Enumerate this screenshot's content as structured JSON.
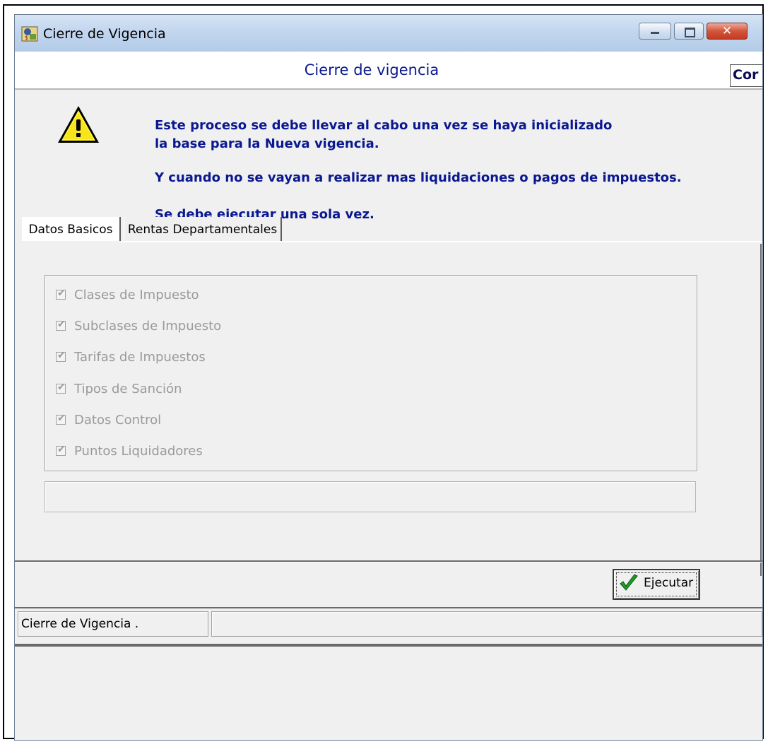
{
  "window": {
    "title": "Cierre de Vigencia",
    "app_icon": "taxes-app-icon",
    "controls": {
      "minimize": "minimize-icon",
      "maximize": "maximize-icon",
      "close": "close-icon"
    },
    "close_glyph": "✕"
  },
  "header": {
    "title": "Cierre de vigencia",
    "right_field_text": "Cor"
  },
  "warning": {
    "icon": "warning-icon",
    "lines": [
      "Este proceso se debe llevar al cabo una vez se haya inicializado",
      "la base para la Nueva vigencia.",
      "Y cuando no se vayan a realizar mas liquidaciones o pagos de impuestos.",
      "Se debe ejecutar una sola vez."
    ]
  },
  "tabs": [
    {
      "label": "Datos Basicos",
      "active": true
    },
    {
      "label": "Rentas Departamentales",
      "active": false
    }
  ],
  "checklist": [
    {
      "label": "Clases de Impuesto",
      "checked": true,
      "enabled": false
    },
    {
      "label": "Subclases de Impuesto",
      "checked": true,
      "enabled": false
    },
    {
      "label": "Tarifas de Impuestos",
      "checked": true,
      "enabled": false
    },
    {
      "label": "Tipos de Sanción",
      "checked": true,
      "enabled": false
    },
    {
      "label": "Datos Control",
      "checked": true,
      "enabled": false
    },
    {
      "label": "Puntos Liquidadores",
      "checked": true,
      "enabled": false
    }
  ],
  "check_glyph": "✔",
  "progress_text": "",
  "footer": {
    "execute_label": "Ejecutar",
    "execute_icon": "green-checkmark-icon"
  },
  "status_bar": {
    "left_text": "Cierre de Vigencia .",
    "right_text": ""
  },
  "colors": {
    "heading_blue": "#0a1a8c",
    "disabled_gray": "#9a9a9a",
    "close_red": "#c23a20"
  }
}
